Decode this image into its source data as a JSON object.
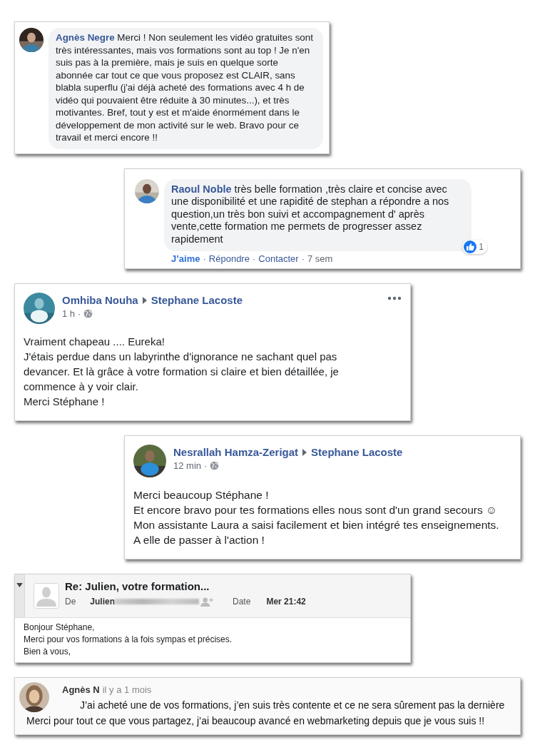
{
  "cards": [
    {
      "kind": "comment",
      "author": "Agnès Negre",
      "text": "Merci ! Non seulement les vidéo gratuites sont très intéressantes, mais vos formations sont au top ! Je n'en suis pas à la première, mais je suis en quelque sorte abonnée car tout ce que vous proposez est CLAIR, sans blabla superflu (j'ai déjà acheté des formations avec 4 h de vidéo qui pouvaient être réduite à 30 minutes...), et très motivantes. Bref, tout y est et m'aide énormément dans le développement de mon activité sur le web. Bravo pour ce travail et merci encore !!"
    },
    {
      "kind": "comment",
      "author": "Raoul Noble",
      "text": "très belle formation ,très claire et concise avec une disponibilité et une rapidité de stephan a répondre a nos question,un très bon suivi et accompagnement d' après vente,cette formation me permets de progresser assez rapidement",
      "actions": [
        "J’aime",
        "Répondre",
        "Contacter"
      ],
      "separator": "·",
      "time": "7 sem",
      "like_count": "1"
    },
    {
      "kind": "post",
      "author": "Omhiba Nouha",
      "target": "Stephane Lacoste",
      "time": "1 h",
      "separator": "·",
      "more_menu": true,
      "paragraphs": [
        "Vraiment chapeau .... Eureka!",
        "J'étais perdue dans un labyrinthe d'ignorance ne sachant quel pas devancer. Et là grâce à votre formation si claire et bien détaillée, je commence à y voir clair.",
        "Merci Stéphane !"
      ]
    },
    {
      "kind": "post",
      "author": "Nesrallah Hamza-Zerigat",
      "target": "Stephane Lacoste",
      "time": "12 min",
      "separator": "·",
      "paragraphs": [
        "Merci beaucoup Stéphane !",
        "Et encore bravo pour tes formations elles nous sont d'un grand secours ☺ Mon assistante Laura a saisi facilement et bien intégré tes enseignements. A elle de passer à l'action !"
      ]
    },
    {
      "kind": "email",
      "subject": "Re: Julien, votre formation...",
      "from_label": "De",
      "from_value": "Julien",
      "date_label": "Date",
      "date_value": "Mer 21:42",
      "lines": [
        "Bonjour Stéphane,",
        "Merci pour vos formations à la fois sympas et précises.",
        "Bien à vous,"
      ]
    },
    {
      "kind": "review",
      "author": "Agnès N",
      "time": "il y a 1 mois",
      "lines": [
        "J’ai acheté une de vos formations, j’en suis très contente et ce ne sera sûrement pas la dernière",
        "Merci pour tout ce que vous partagez, j’ai beaucoup avancé en webmarketing depuis que je vous suis !!"
      ]
    }
  ]
}
